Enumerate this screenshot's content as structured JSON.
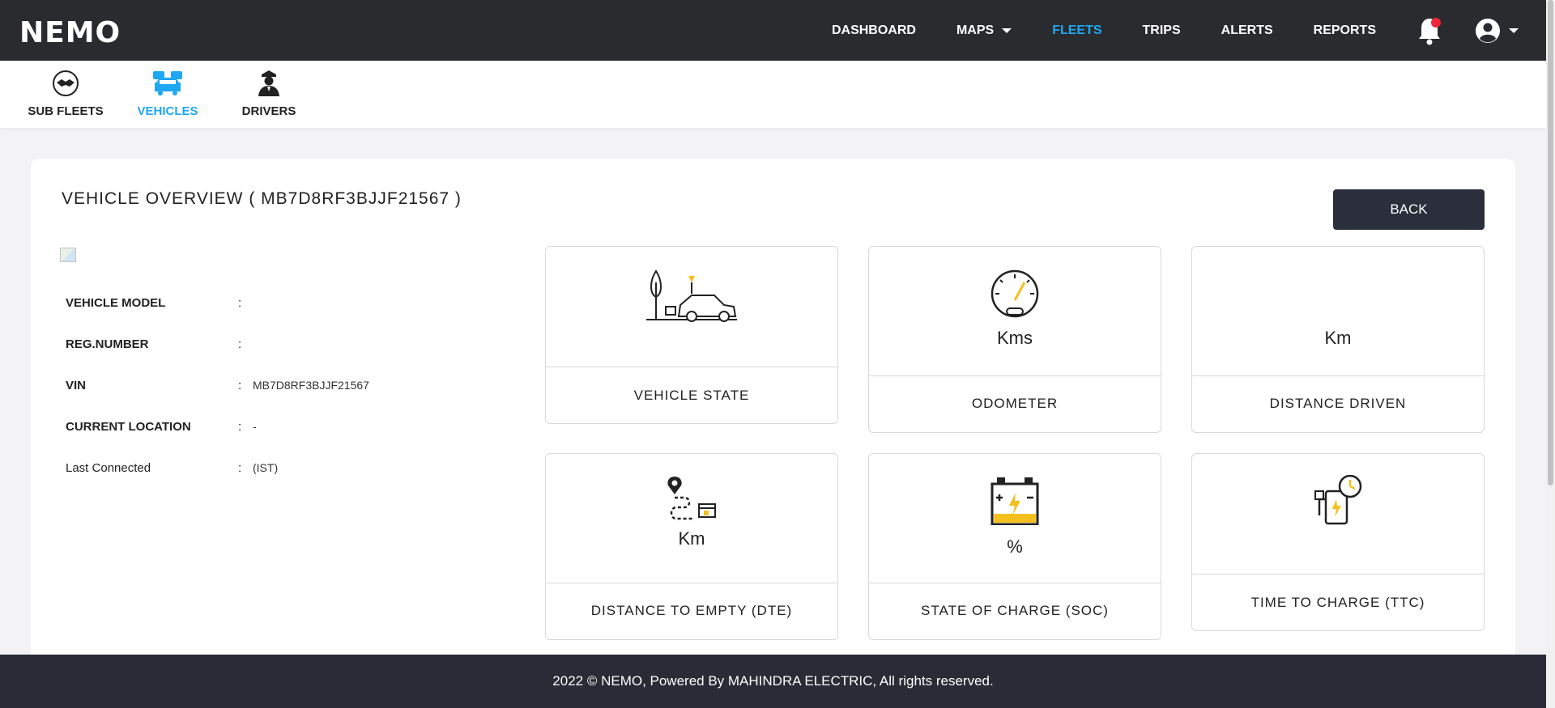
{
  "header": {
    "logo": "NEMO",
    "nav": [
      {
        "label": "DASHBOARD"
      },
      {
        "label": "MAPS"
      },
      {
        "label": "FLEETS"
      },
      {
        "label": "TRIPS"
      },
      {
        "label": "ALERTS"
      },
      {
        "label": "REPORTS"
      }
    ]
  },
  "subnav": {
    "tabs": [
      {
        "label": "SUB FLEETS"
      },
      {
        "label": "VEHICLES"
      },
      {
        "label": "DRIVERS"
      }
    ]
  },
  "overview": {
    "title": "VEHICLE OVERVIEW ( MB7D8RF3BJJF21567 )",
    "back_label": "BACK",
    "fields": [
      {
        "key": "VEHICLE MODEL",
        "sep": ":",
        "value": ""
      },
      {
        "key": "REG.NUMBER",
        "sep": ":",
        "value": ""
      },
      {
        "key": "VIN",
        "sep": ":",
        "value": "MB7D8RF3BJJF21567"
      },
      {
        "key": "CURRENT LOCATION",
        "sep": ":",
        "value": "-"
      },
      {
        "key": "Last Connected",
        "sep": ":",
        "value": "(IST)"
      }
    ]
  },
  "metrics": {
    "vehicle_state": {
      "label": "VEHICLE STATE"
    },
    "odometer": {
      "unit": "Kms",
      "label": "ODOMETER"
    },
    "distance_driven": {
      "unit": "Km",
      "label": "DISTANCE DRIVEN"
    },
    "dte": {
      "unit": "Km",
      "label": "DISTANCE TO EMPTY (DTE)"
    },
    "soc": {
      "unit": "%",
      "label": "STATE OF CHARGE (SOC)"
    },
    "ttc": {
      "label": "TIME TO CHARGE (TTC)"
    }
  },
  "footer": {
    "text": "2022 © NEMO, Powered By MAHINDRA ELECTRIC, All rights reserved."
  },
  "colors": {
    "accent": "#1ea7f2",
    "topbar": "#2a2b2e",
    "footer": "#292b37",
    "icon_yellow": "#f4c01e"
  }
}
